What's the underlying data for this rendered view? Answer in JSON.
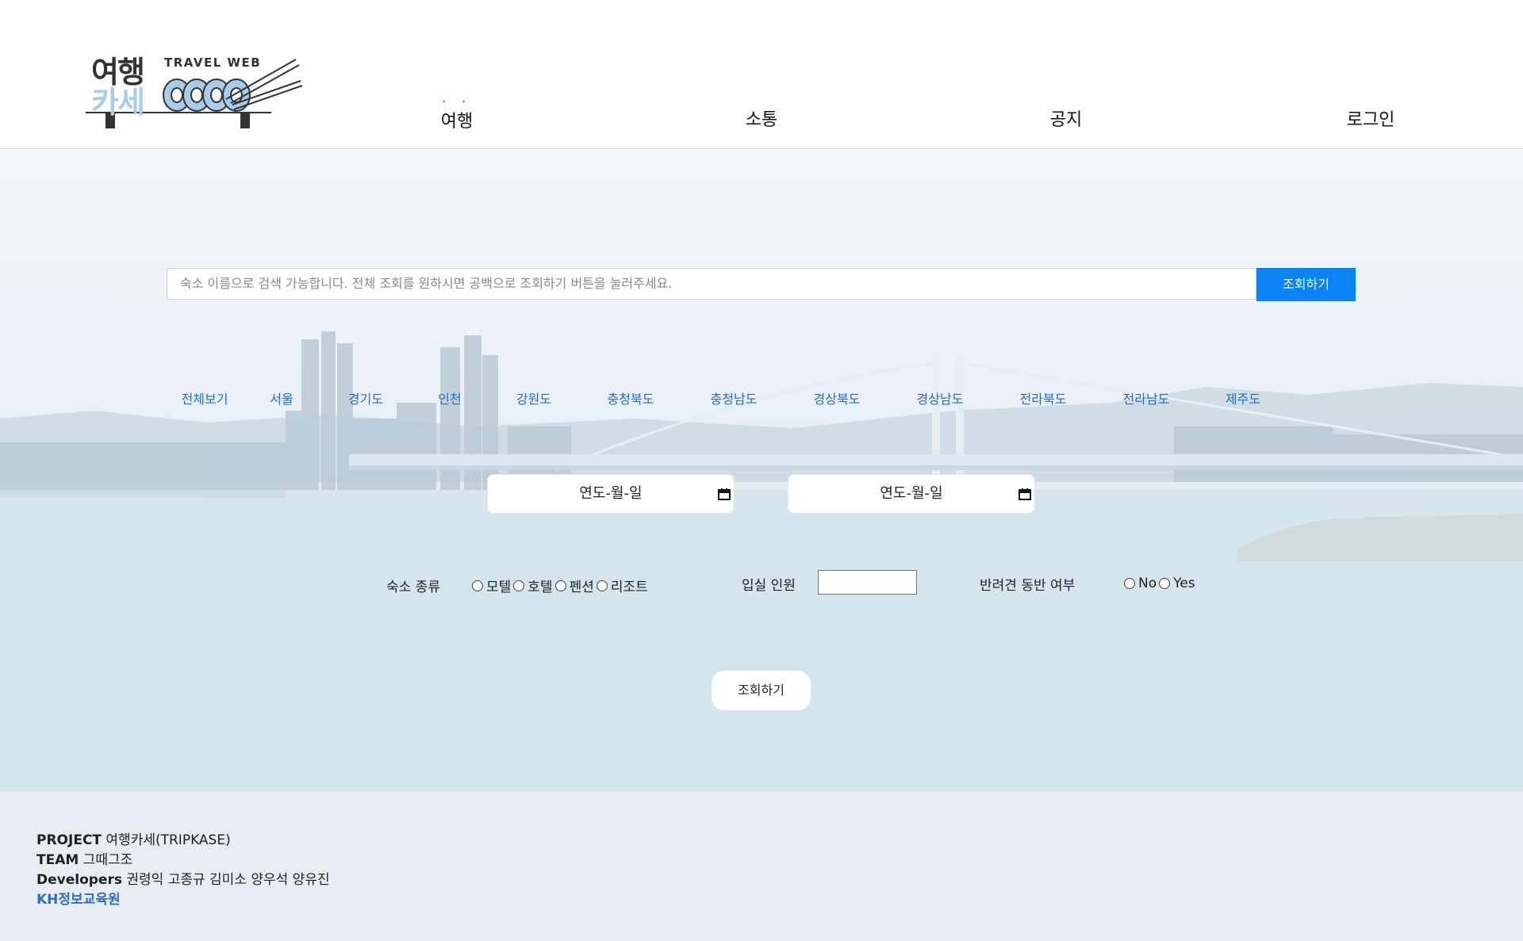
{
  "header": {
    "logo": {
      "title_line1": "여행",
      "title_line2": "카세",
      "subtitle": "TRAVEL WEB"
    },
    "nav": [
      {
        "label": "여행",
        "dots": "· ·"
      },
      {
        "label": "소통"
      },
      {
        "label": "공지"
      },
      {
        "label": "로그인"
      }
    ]
  },
  "search": {
    "placeholder": "숙소 이름으로 검색 가능합니다. 전체 조회를 원하시면 공백으로 조회하기 버튼을 눌러주세요.",
    "button_label": "조회하기"
  },
  "regions": [
    "전체보기",
    "서울",
    "경기도",
    "인천",
    "강원도",
    "충청북도",
    "충청남도",
    "경상북도",
    "경상남도",
    "전라북도",
    "전라남도",
    "제주도"
  ],
  "dates": {
    "checkin_placeholder": "연도-월-일",
    "checkout_placeholder": "연도-월-일"
  },
  "filters": {
    "type_label": "숙소 종류",
    "type_options": [
      "모텔",
      "호텔",
      "펜션",
      "리조트"
    ],
    "people_label": "입실 인원",
    "people_value": "",
    "pet_label": "반려견 동반 여부",
    "pet_options": [
      "No",
      "Yes"
    ]
  },
  "submit_label": "조회하기",
  "footer": {
    "project_key": "PROJECT",
    "project_value": "여행카세(TRIPKASE)",
    "team_key": "TEAM",
    "team_value": "그때그조",
    "dev_key": "Developers",
    "dev_value": "권령익 고종규 김미소 양우석 양유진",
    "org": "KH정보교육원"
  },
  "colors": {
    "accent": "#0a84f5",
    "region_link": "#1e6fd0",
    "footer_bg": "#e8ecf3",
    "org": "#2f6fc2"
  }
}
